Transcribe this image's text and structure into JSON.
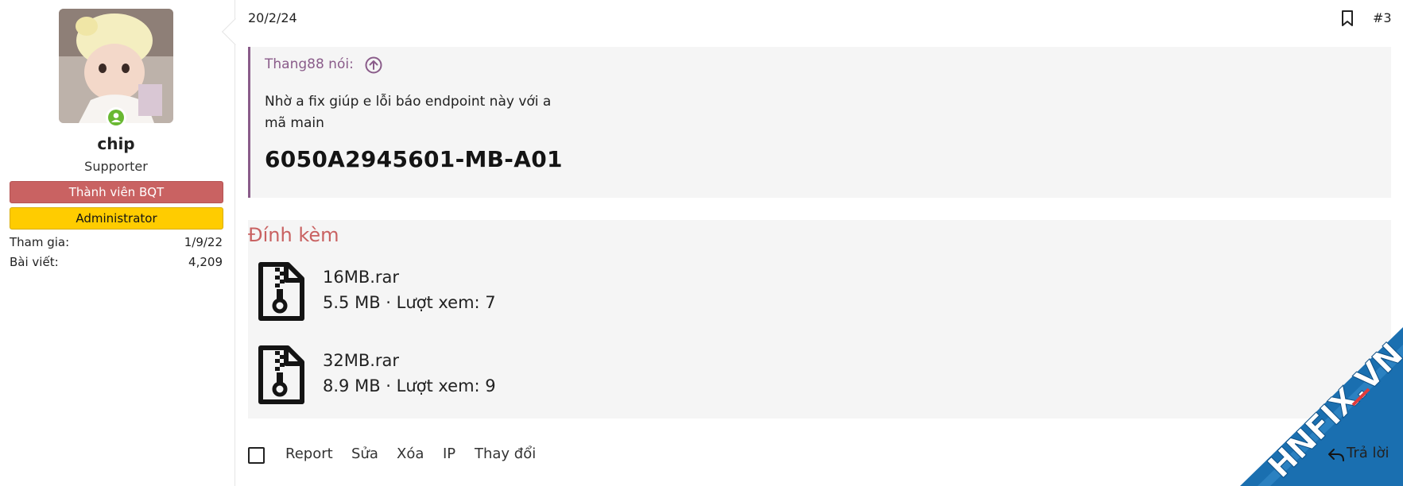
{
  "user": {
    "name": "chip",
    "title": "Supporter",
    "banners": [
      "Thành viên BQT",
      "Administrator"
    ],
    "stats": [
      {
        "label": "Tham gia:",
        "value": "1/9/22"
      },
      {
        "label": "Bài viết:",
        "value": "4,209"
      }
    ]
  },
  "post": {
    "date": "20/2/24",
    "number": "#3"
  },
  "quote": {
    "author": "Thang88 nói:",
    "lines": [
      "Nhờ a fix giúp e lỗi báo endpoint này với a",
      "mã main"
    ],
    "code": "6050A2945601-MB-A01"
  },
  "attachments": {
    "title": "Đính kèm",
    "items": [
      {
        "name": "16MB.rar",
        "meta": "5.5 MB · Lượt xem: 7"
      },
      {
        "name": "32MB.rar",
        "meta": "8.9 MB · Lượt xem: 9"
      }
    ]
  },
  "actions": [
    "Report",
    "Sửa",
    "Xóa",
    "IP",
    "Thay đổi"
  ],
  "reply_label": "Trả lời",
  "watermark": "HNFIX.VN",
  "colors": {
    "quote_accent": "#8a5c8a",
    "bqt_banner": "#c96262",
    "admin_banner": "#ffcc00",
    "online": "#69b832",
    "attach_title": "#c96262",
    "watermark_bg": "#1a6fb0"
  },
  "icons": [
    "online-status-icon",
    "bookmark-icon",
    "arrow-up-circle-icon",
    "zip-file-icon",
    "checkbox-icon",
    "reply-icon"
  ]
}
